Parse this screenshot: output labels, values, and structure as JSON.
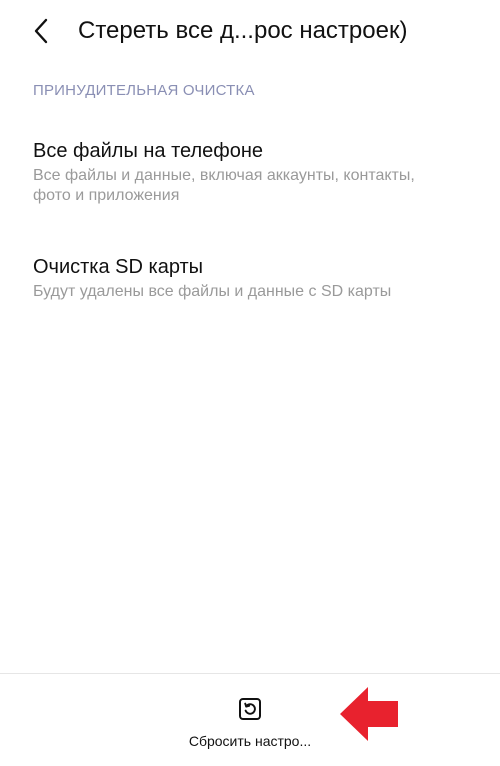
{
  "header": {
    "back_icon": "chevron-left-icon",
    "title": "Стереть все д...рос настроек)"
  },
  "section": {
    "title": "ПРИНУДИТЕЛЬНАЯ ОЧИСТКА"
  },
  "items": [
    {
      "title": "Все файлы на телефоне",
      "subtitle": "Все файлы и данные, включая аккаунты, контакты, фото и приложения"
    },
    {
      "title": "Очистка SD карты",
      "subtitle": "Будут удалены все файлы и данные с SD карты"
    }
  ],
  "bottom_bar": {
    "reset_icon": "reset-icon",
    "reset_label": "Сбросить настро..."
  },
  "annotation": {
    "arrow_icon": "red-arrow-icon",
    "arrow_color": "#e8222e"
  },
  "colors": {
    "section_title": "#8a8fb4",
    "subtitle": "#9a9a9a",
    "text": "#111111"
  }
}
